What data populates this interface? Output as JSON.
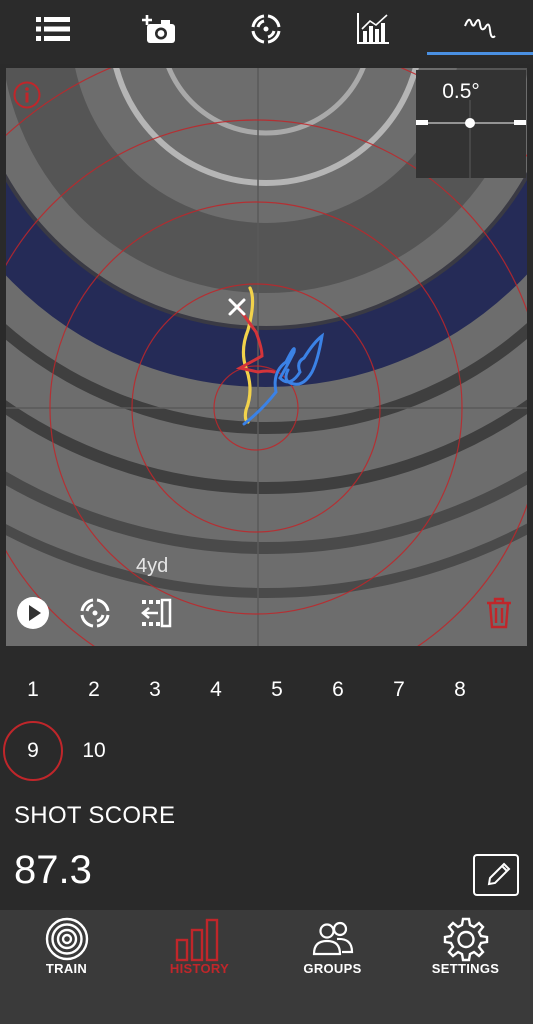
{
  "top_tabs": [
    {
      "id": "list",
      "icon": "list-icon"
    },
    {
      "id": "add-photo",
      "icon": "add-camera-icon"
    },
    {
      "id": "target-view",
      "icon": "target-segments-icon"
    },
    {
      "id": "stats",
      "icon": "bar-chart-icon"
    },
    {
      "id": "trace",
      "icon": "trace-squiggle-icon",
      "active": true
    }
  ],
  "target": {
    "angle_label": "0.5°",
    "distance_label": "4yd",
    "trace_colors": {
      "before": "#f2d24b",
      "aim": "#d4343a",
      "after": "#3b82e6"
    }
  },
  "shots": {
    "items": [
      "1",
      "2",
      "3",
      "4",
      "5",
      "6",
      "7",
      "8",
      "9",
      "10"
    ],
    "selected": "9"
  },
  "score": {
    "label": "SHOT SCORE",
    "value": "87.3"
  },
  "bottom_nav": [
    {
      "label": "TRAIN",
      "icon": "target-icon"
    },
    {
      "label": "HISTORY",
      "icon": "bar-chart-icon",
      "active": true
    },
    {
      "label": "GROUPS",
      "icon": "people-icon"
    },
    {
      "label": "SETTINGS",
      "icon": "gear-icon"
    }
  ],
  "colors": {
    "accent_red": "#c0262a",
    "accent_blue": "#4a90e2"
  }
}
